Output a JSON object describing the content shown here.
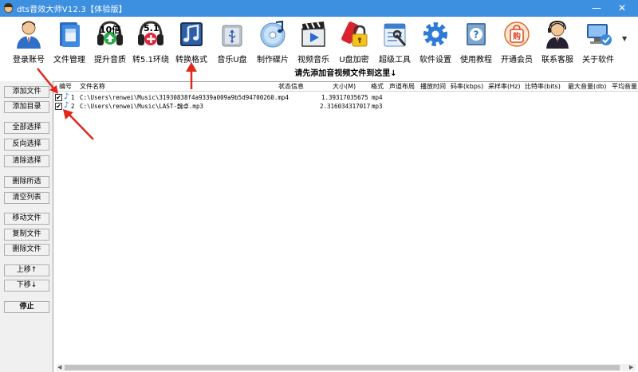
{
  "window": {
    "title": "dts音效大师V12.3【体验版】",
    "minimize": "—",
    "close": "✕"
  },
  "toolbar": {
    "items": [
      {
        "label": "登录账号",
        "icon": "user-icon"
      },
      {
        "label": "文件管理",
        "icon": "folder-icon"
      },
      {
        "label": "提升音质",
        "icon": "headphones-10x-icon",
        "badge": "10倍"
      },
      {
        "label": "转5.1环绕",
        "icon": "headphones-51-icon",
        "badge": "5.1"
      },
      {
        "label": "转换格式",
        "icon": "music-note-icon"
      },
      {
        "label": "音乐U盘",
        "icon": "usb-icon"
      },
      {
        "label": "制作碟片",
        "icon": "disc-icon"
      },
      {
        "label": "视频音乐",
        "icon": "video-icon"
      },
      {
        "label": "U盘加密",
        "icon": "lock-icon"
      },
      {
        "label": "超级工具",
        "icon": "tools-icon"
      },
      {
        "label": "软件设置",
        "icon": "settings-gear-icon"
      },
      {
        "label": "使用教程",
        "icon": "help-icon"
      },
      {
        "label": "开通会员",
        "icon": "shopping-bag-icon",
        "badge": "购"
      },
      {
        "label": "联系客服",
        "icon": "support-agent-icon"
      },
      {
        "label": "关于软件",
        "icon": "computer-icon"
      }
    ],
    "more": "▼"
  },
  "banner": "请先添加音视频文件到这里↓",
  "left_buttons": {
    "add_file": "添加文件",
    "add_folder": "添加目录",
    "select_all": "全部选择",
    "invert_select": "反向选择",
    "clear_select": "清除选择",
    "delete_selected": "删除所选",
    "clear_list": "清空列表",
    "move_file": "移动文件",
    "copy_file": "复制文件",
    "delete_file": "删除文件",
    "move_up": "上移↑",
    "move_down": "下移↓",
    "stop": "停止"
  },
  "table": {
    "columns": [
      "编号",
      "文件名称",
      "状态信息",
      "大小(M)",
      "格式",
      "声道布局",
      "播放时间",
      "码率(kbps)",
      "采样率(Hz)",
      "比特率(bits)",
      "最大音量(db)",
      "平均音量"
    ],
    "rows": [
      {
        "no": "1",
        "name": "C:\\Users\\renwei\\Music\\31930838f4a9339a009a9b5d94700260.mp4",
        "status": "",
        "size": "1.39317035675",
        "format": "mp4",
        "checked": "✔"
      },
      {
        "no": "2",
        "name": "C:\\Users\\renwei\\Music\\LAST-魏卓.mp3",
        "status": "",
        "size": "2.316034317017",
        "format": "mp3",
        "checked": "✔"
      }
    ]
  },
  "scrollbar": {
    "left": "◀",
    "right": "▶"
  },
  "colors": {
    "titlebar": "#3d8fe0",
    "annotation_arrow": "#e0281c",
    "note_icon": "#1e6fd6"
  }
}
